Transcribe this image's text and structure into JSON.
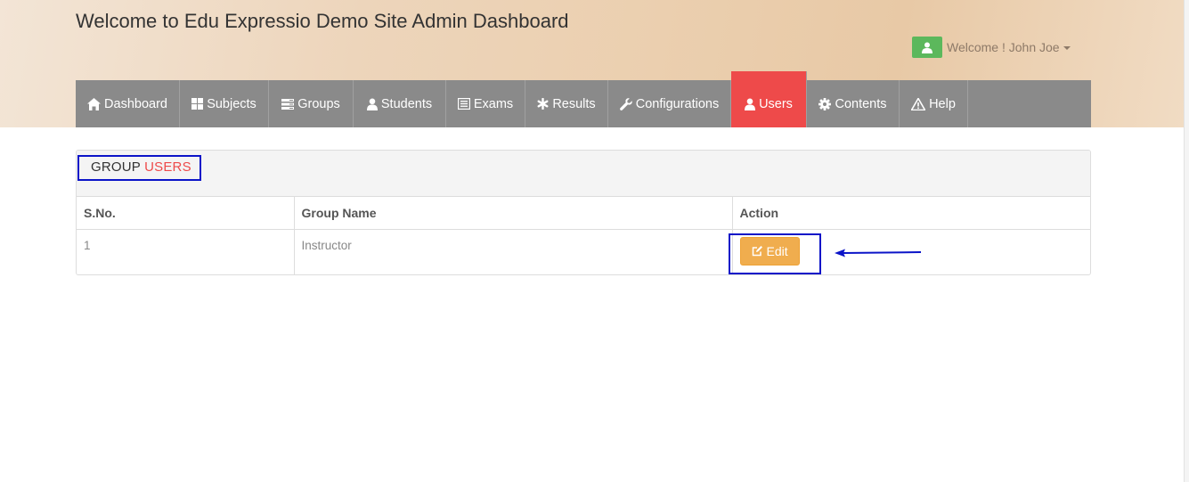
{
  "header": {
    "site_title": "Welcome to Edu Expressio Demo Site Admin Dashboard",
    "welcome_text": "Welcome ! John Joe"
  },
  "nav": {
    "items": [
      {
        "label": "Dashboard",
        "icon": "home-icon"
      },
      {
        "label": "Subjects",
        "icon": "th-large-icon"
      },
      {
        "label": "Groups",
        "icon": "tasks-icon"
      },
      {
        "label": "Students",
        "icon": "user-icon"
      },
      {
        "label": "Exams",
        "icon": "list-alt-icon"
      },
      {
        "label": "Results",
        "icon": "asterisk-icon"
      },
      {
        "label": "Configurations",
        "icon": "wrench-icon"
      },
      {
        "label": "Users",
        "icon": "user-icon",
        "active": true
      },
      {
        "label": "Contents",
        "icon": "cog-icon"
      },
      {
        "label": "Help",
        "icon": "warning-sign-icon"
      }
    ]
  },
  "panel": {
    "title_word1": "GROUP",
    "title_word2": "USERS",
    "columns": [
      "S.No.",
      "Group Name",
      "Action"
    ],
    "rows": [
      {
        "sno": "1",
        "group_name": "Instructor",
        "action_label": "Edit"
      }
    ]
  },
  "colors": {
    "nav_bg": "#8a8a8a",
    "active_tab": "#ee4a4a",
    "accent_text": "#ee4a4a",
    "edit_button": "#f0ad4e",
    "welcome_badge": "#5cb85c",
    "annotation": "#0b14c8"
  }
}
